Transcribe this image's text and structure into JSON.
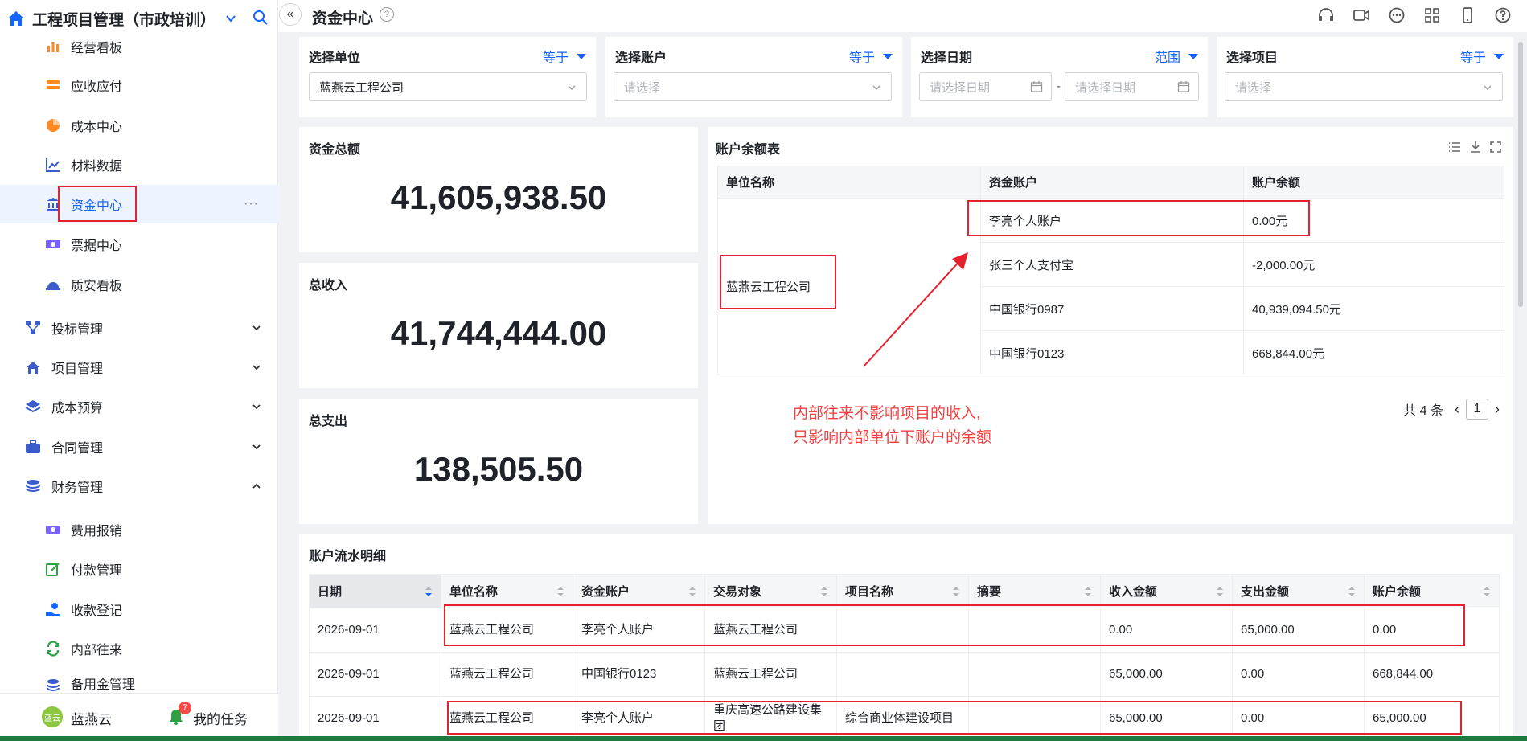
{
  "app": {
    "title": "工程项目管理（市政培训）",
    "user": "蓝燕云",
    "avatar_text": "蓝云",
    "tasks_label": "我的任务",
    "task_count": "7"
  },
  "sidebar": {
    "sub_items": [
      {
        "label": "经营看板",
        "icon": "bar-chart-icon"
      },
      {
        "label": "应收应付",
        "icon": "stack-icon"
      },
      {
        "label": "成本中心",
        "icon": "pie-chart-icon"
      },
      {
        "label": "材料数据",
        "icon": "line-chart-icon"
      },
      {
        "label": "资金中心",
        "icon": "bank-icon",
        "active": true
      },
      {
        "label": "票据中心",
        "icon": "money-icon"
      },
      {
        "label": "质安看板",
        "icon": "helmet-icon"
      }
    ],
    "groups": [
      {
        "label": "投标管理",
        "icon": "flow-icon"
      },
      {
        "label": "项目管理",
        "icon": "house-flag-icon"
      },
      {
        "label": "成本预算",
        "icon": "layers-icon"
      },
      {
        "label": "合同管理",
        "icon": "briefcase-icon"
      },
      {
        "label": "财务管理",
        "icon": "coins-icon",
        "expanded": true
      }
    ],
    "finance_items": [
      {
        "label": "费用报销",
        "icon": "money-icon"
      },
      {
        "label": "付款管理",
        "icon": "edit-icon"
      },
      {
        "label": "收款登记",
        "icon": "hand-coin-icon"
      },
      {
        "label": "内部往来",
        "icon": "refresh-icon"
      },
      {
        "label": "备用金管理",
        "icon": "coins-icon"
      }
    ],
    "more": "···"
  },
  "header": {
    "page_title": "资金中心",
    "help": "?"
  },
  "filters": [
    {
      "label": "选择单位",
      "op": "等于",
      "value": "蓝燕云工程公司"
    },
    {
      "label": "选择账户",
      "op": "等于",
      "placeholder": "请选择"
    },
    {
      "label": "选择日期",
      "op": "范围",
      "start_placeholder": "请选择日期",
      "end_placeholder": "请选择日期",
      "sep": "-"
    },
    {
      "label": "选择项目",
      "op": "等于",
      "placeholder": "请选择"
    }
  ],
  "kpis": [
    {
      "label": "资金总额",
      "value": "41,605,938.50"
    },
    {
      "label": "总收入",
      "value": "41,744,444.00"
    },
    {
      "label": "总支出",
      "value": "138,505.50"
    }
  ],
  "balance": {
    "title": "账户余额表",
    "columns": [
      "单位名称",
      "资金账户",
      "账户余额"
    ],
    "unit": "蓝燕云工程公司",
    "rows": [
      {
        "account": "李亮个人账户",
        "balance": "0.00元"
      },
      {
        "account": "张三个人支付宝",
        "balance": "-2,000.00元"
      },
      {
        "account": "中国银行0987",
        "balance": "40,939,094.50元"
      },
      {
        "account": "中国银行0123",
        "balance": "668,844.00元"
      }
    ],
    "total": "共 4 条",
    "page": "1",
    "note_line1": "内部往来不影响项目的收入,",
    "note_line2": "只影响内部单位下账户的余额"
  },
  "flow": {
    "title": "账户流水明细",
    "columns": [
      "日期",
      "单位名称",
      "资金账户",
      "交易对象",
      "项目名称",
      "摘要",
      "收入金额",
      "支出金额",
      "账户余额"
    ],
    "rows": [
      [
        "2026-09-01",
        "蓝燕云工程公司",
        "李亮个人账户",
        "蓝燕云工程公司",
        "",
        "",
        "0.00",
        "65,000.00",
        "0.00"
      ],
      [
        "2026-09-01",
        "蓝燕云工程公司",
        "中国银行0123",
        "蓝燕云工程公司",
        "",
        "",
        "65,000.00",
        "0.00",
        "668,844.00"
      ],
      [
        "2026-09-01",
        "蓝燕云工程公司",
        "李亮个人账户",
        "重庆高速公路建设集团",
        "综合商业体建设项目",
        "",
        "65,000.00",
        "0.00",
        "65,000.00"
      ]
    ]
  },
  "colors": {
    "accent": "#1664ff",
    "annotation": "#e8202c"
  }
}
